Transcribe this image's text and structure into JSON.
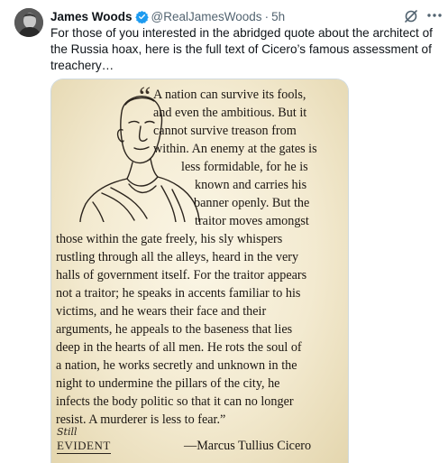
{
  "author": {
    "name": "James Woods",
    "handle": "@RealJamesWoods",
    "separator": "·",
    "time": "5h"
  },
  "tweet": {
    "text": "For those of you interested in the abridged quote about the architect of the Russia hoax, here is the full text of Cicero’s famous assessment of treachery…"
  },
  "image": {
    "quote_open": "“",
    "lines": [
      "A nation can survive its fools,",
      "and even the ambitious. But it",
      "cannot survive treason from",
      "within. An enemy at the gates is",
      "less formidable, for he is",
      "known and carries his",
      "banner openly. But the",
      "traitor moves amongst",
      "those within the gate freely, his sly whispers",
      "rustling through all the alleys, heard in the very",
      "halls of government itself. For the traitor appears",
      "not a traitor; he speaks in accents familiar to his",
      "victims, and he wears their face and their",
      "arguments, he appeals to the baseness that lies",
      "deep in the hearts of all men. He rots the soul of",
      "a nation, he works secretly and unknown in the",
      "night to undermine the pillars of the city, he",
      "infects the body politic so that it can no longer",
      "resist. A murderer is less to fear.”"
    ],
    "signature": "—Marcus Tullius Cicero",
    "logo_top": "Still",
    "logo_bottom": "EVIDENT"
  },
  "colors": {
    "verified": "#1d9bf0",
    "secondary_text": "#536471",
    "paper": "#f3ead0"
  },
  "icons": {
    "verified": "verified-badge-icon",
    "grok": "grok-icon",
    "more": "more-icon"
  }
}
